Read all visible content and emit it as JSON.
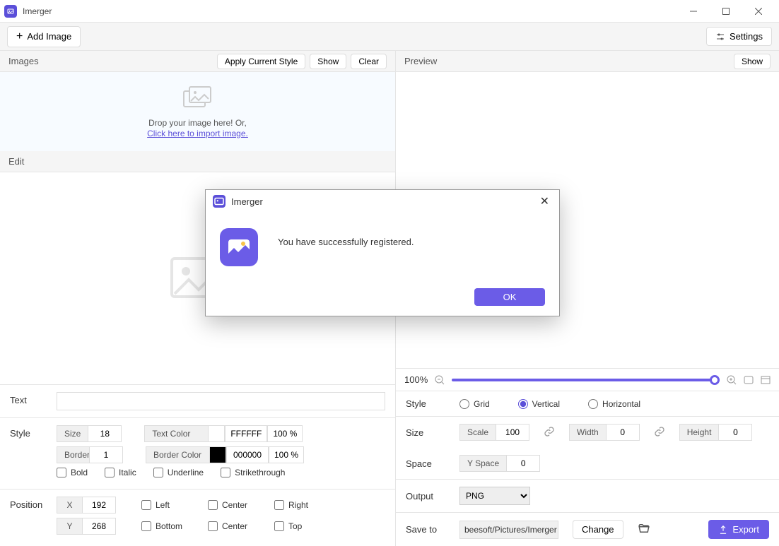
{
  "app": {
    "title": "Imerger"
  },
  "toolbar": {
    "add_image": "Add Image",
    "settings": "Settings"
  },
  "images_panel": {
    "title": "Images",
    "apply_style": "Apply Current Style",
    "show": "Show",
    "clear": "Clear",
    "drop_text": "Drop your image here! Or,",
    "import_link": "Click here to import image."
  },
  "edit_panel": {
    "title": "Edit"
  },
  "text_section": {
    "label": "Text",
    "value": ""
  },
  "style_section": {
    "label": "Style",
    "size_label": "Size",
    "size_value": "18",
    "textcolor_label": "Text Color",
    "textcolor_value": "FFFFFF",
    "textcolor_pct": "100 %",
    "border_label": "Border",
    "border_value": "1",
    "bordercolor_label": "Border Color",
    "bordercolor_value": "000000",
    "bordercolor_pct": "100 %",
    "bold": "Bold",
    "italic": "Italic",
    "underline": "Underline",
    "strike": "Strikethrough"
  },
  "position_section": {
    "label": "Position",
    "x_label": "X",
    "x_value": "192",
    "y_label": "Y",
    "y_value": "268",
    "left": "Left",
    "center1": "Center",
    "right": "Right",
    "bottom": "Bottom",
    "center2": "Center",
    "top": "Top"
  },
  "preview_panel": {
    "title": "Preview",
    "show": "Show"
  },
  "zoom": {
    "pct": "100%"
  },
  "r_style": {
    "label": "Style",
    "grid": "Grid",
    "vertical": "Vertical",
    "horizontal": "Horizontal",
    "selected": "vertical"
  },
  "r_size": {
    "label": "Size",
    "scale_label": "Scale",
    "scale_value": "100",
    "width_label": "Width",
    "width_value": "0",
    "height_label": "Height",
    "height_value": "0",
    "space_row_label": "Space",
    "yspace_label": "Y Space",
    "yspace_value": "0"
  },
  "output": {
    "label": "Output",
    "format": "PNG"
  },
  "saveto": {
    "label": "Save to",
    "path": "beesoft/Pictures/Imerger",
    "change": "Change",
    "export": "Export"
  },
  "modal": {
    "title": "Imerger",
    "message": "You have successfully registered.",
    "ok": "OK"
  }
}
